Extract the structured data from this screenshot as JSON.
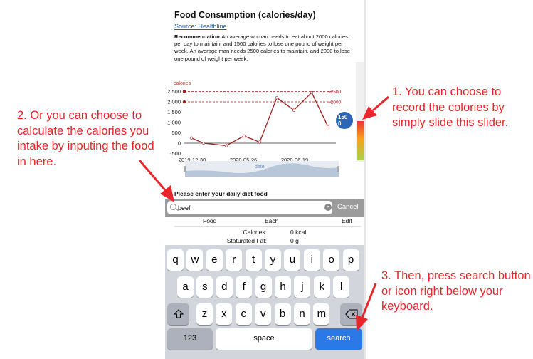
{
  "app": {
    "title": "Food Consumption (calories/day)",
    "source_link": "Source: Healthline",
    "recommendation_label": "Recommendation:",
    "recommendation_text": "An average woman needs to eat about 2000 calories per day to maintain, and 1500 calories to lose one pound of weight per week. An average man needs 2500 calories to maintain, and 2000 to lose one pound of weight per week."
  },
  "chart": {
    "ylabel": "calories",
    "yticks": [
      "2,500",
      "2,000",
      "1,500",
      "1,000",
      "500",
      "0",
      "-500"
    ],
    "xticks": [
      "2019-12-30",
      "2020-05-26",
      "2020-06-19"
    ],
    "xlabel": "date",
    "ref_labels": [
      "2500",
      "2000"
    ],
    "series_values": [
      250,
      0,
      -120,
      350,
      50,
      2200,
      1600,
      2450,
      800
    ],
    "ref_values": [
      2500,
      2000
    ],
    "line_color": "#a11d1d"
  },
  "slider": {
    "value_label": "150\n0",
    "value": 1500
  },
  "diet": {
    "prompt": "Please enter your daily diet food",
    "search_value": "beef",
    "cancel_label": "Cancel",
    "columns": [
      "Food",
      "Each",
      "Edit"
    ],
    "nutrients": [
      {
        "name": "Calories:",
        "value": "0 kcal"
      },
      {
        "name": "Staturated Fat:",
        "value": "0 g"
      }
    ]
  },
  "keyboard": {
    "row1": [
      "q",
      "w",
      "e",
      "r",
      "t",
      "y",
      "u",
      "i",
      "o",
      "p"
    ],
    "row2": [
      "a",
      "s",
      "d",
      "f",
      "g",
      "h",
      "j",
      "k",
      "l"
    ],
    "row3": [
      "z",
      "x",
      "c",
      "v",
      "b",
      "n",
      "m"
    ],
    "numbers_label": "123",
    "space_label": "space",
    "search_label": "search"
  },
  "annotations": {
    "note1": "1. You can choose to record the colories by simply slide this slider.",
    "note2": "2. Or you can choose to calculate the calories you intake by inputing the food in here.",
    "note3": "3. Then, press search button or icon right below your keyboard."
  },
  "colors": {
    "annotation": "#e8252a",
    "search_key": "#2b79e7",
    "slider_knob": "#2e66b5"
  }
}
